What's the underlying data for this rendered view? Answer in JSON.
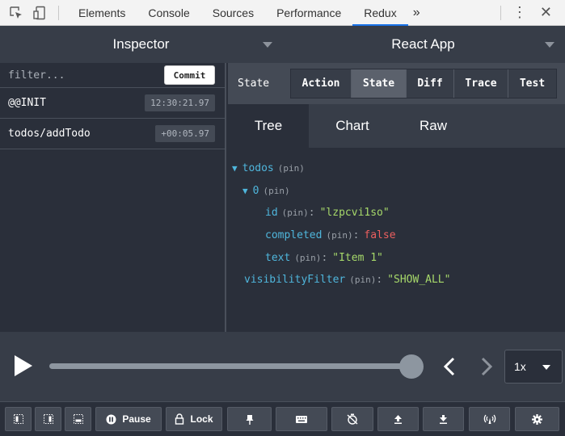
{
  "devtools": {
    "tabs": [
      "Elements",
      "Console",
      "Sources",
      "Performance",
      "Redux"
    ],
    "active_tab": "Redux",
    "more_icon": "chevron-double-right-icon"
  },
  "header": {
    "left_select": "Inspector",
    "right_select": "React App"
  },
  "left_panel": {
    "filter_placeholder": "filter...",
    "commit_label": "Commit",
    "actions": [
      {
        "name": "@@INIT",
        "time": "12:30:21.97"
      },
      {
        "name": "todos/addTodo",
        "time": "+00:05.97"
      }
    ]
  },
  "right_panel": {
    "label": "State",
    "tabs": [
      "Action",
      "State",
      "Diff",
      "Trace",
      "Test"
    ],
    "active_tab": "State",
    "subtabs": [
      "Tree",
      "Chart",
      "Raw"
    ],
    "active_subtab": "Tree",
    "pin": "(pin)",
    "tree": {
      "todos_key": "todos",
      "index_key": "0",
      "id_key": "id",
      "id_value": "\"lzpcvi1so\"",
      "completed_key": "completed",
      "completed_value": "false",
      "text_key": "text",
      "text_value": "\"Item 1\"",
      "vf_key": "visibilityFilter",
      "vf_value": "\"SHOW_ALL\""
    }
  },
  "slider": {
    "position": 1.0,
    "speed": "1x"
  },
  "toolbar": {
    "pause_label": "Pause",
    "lock_label": "Lock"
  },
  "colors": {
    "key": "#4fb6dc",
    "string": "#a6d86a",
    "boolean": "#ec5f5f",
    "background": "#2a2f3a"
  }
}
